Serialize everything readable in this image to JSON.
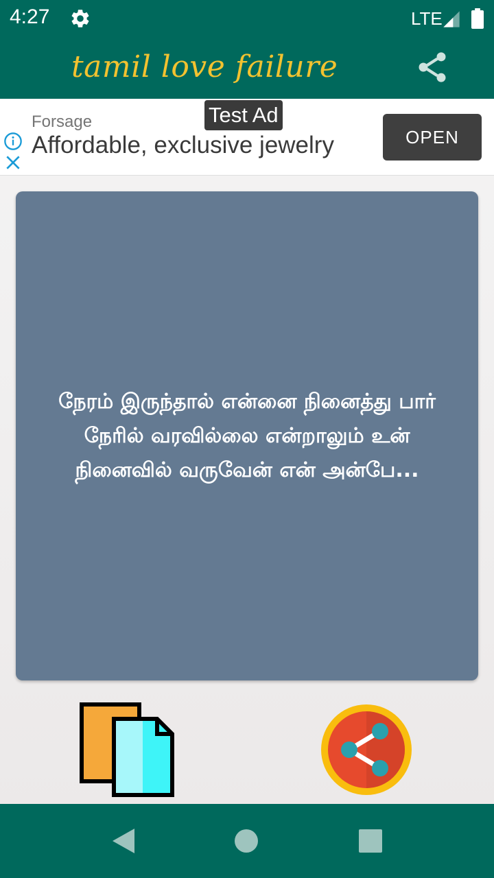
{
  "status_bar": {
    "time": "4:27",
    "network": "LTE",
    "icons": [
      "gear-icon",
      "signal-icon",
      "battery-icon"
    ]
  },
  "app_bar": {
    "title": "tamil love failure",
    "share_icon": "share-icon"
  },
  "ad": {
    "badge": "Test Ad",
    "advertiser": "Forsage",
    "headline": "Affordable, exclusive jewelry",
    "cta": "OPEN",
    "icons": [
      "info-icon",
      "close-icon"
    ]
  },
  "quote": {
    "text": "நேரம் இருந்தால் என்னை நினைத்து பார் நேரில் வரவில்லை என்றாலும் உன் நினைவில் வருவேன் என் அன்பே..."
  },
  "actions": {
    "copy_icon": "copy-icon",
    "share_icon": "share-circle-icon"
  },
  "nav_bar": {
    "icons": [
      "back-icon",
      "home-icon",
      "recents-icon"
    ]
  },
  "colors": {
    "primary": "#00695c",
    "title": "#f2c230",
    "card": "#647a92",
    "ad_button": "#3f3f3f"
  }
}
